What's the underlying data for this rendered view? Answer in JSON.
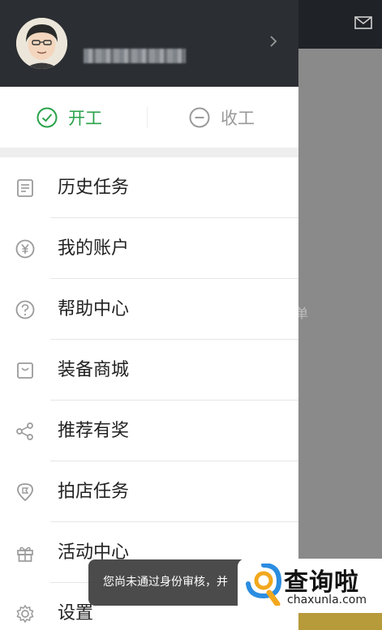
{
  "background_app": {
    "mail_icon": "mail-icon",
    "peek_text": "单",
    "colors": {
      "topbar": "#1f2227",
      "content": "#8a8a8a",
      "accent": "#b79a3a"
    }
  },
  "drawer": {
    "header": {
      "avatar_icon": "avatar-cartoon",
      "chevron_icon": "chevron-right-icon"
    },
    "work": {
      "start_label": "开工",
      "start_icon": "check-circle-icon",
      "stop_label": "收工",
      "stop_icon": "minus-circle-icon",
      "active_color": "#2aa24a"
    },
    "menu": [
      {
        "label": "历史任务",
        "icon": "history-list-icon"
      },
      {
        "label": "我的账户",
        "icon": "yen-coin-icon"
      },
      {
        "label": "帮助中心",
        "icon": "help-circle-icon"
      },
      {
        "label": "装备商城",
        "icon": "shopping-bag-icon"
      },
      {
        "label": "推荐有奖",
        "icon": "share-icon"
      },
      {
        "label": "拍店任务",
        "icon": "location-pin-icon"
      },
      {
        "label": "活动中心",
        "icon": "gift-icon"
      },
      {
        "label": "设置",
        "icon": "settings-gear-icon"
      }
    ]
  },
  "toast": {
    "text": "您尚未通过身份审核，并"
  },
  "watermark": {
    "name": "查询啦",
    "domain": "chaxunla.com"
  }
}
